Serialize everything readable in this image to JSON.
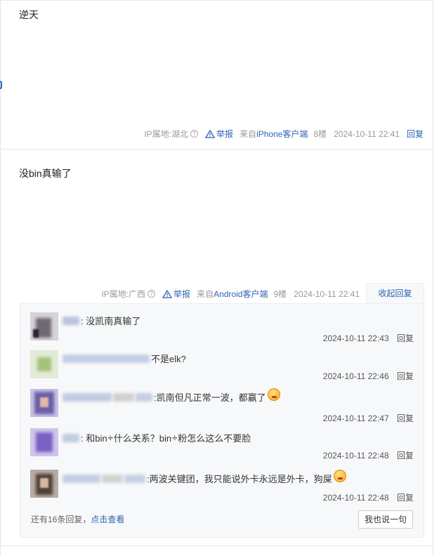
{
  "posts": [
    {
      "text": "逆天",
      "meta": {
        "ip": "IP属地:湖北",
        "report": "举报",
        "from": "来自",
        "client": "iPhone客户端",
        "floor": "8楼",
        "time": "2024-10-11 22:41",
        "reply": "回复"
      }
    },
    {
      "text": "没bin真输了",
      "meta": {
        "ip": "IP属地:广西",
        "report": "举报",
        "from": "来自",
        "client": "Android客户端",
        "floor": "9楼",
        "time": "2024-10-11 22:41",
        "reply": "收起回复"
      }
    }
  ],
  "subreplies": [
    {
      "text": ": 没凯南真输了",
      "time": "2024-10-11 22:43",
      "reply": "回复"
    },
    {
      "text": " 不是elk?",
      "time": "2024-10-11 22:46",
      "reply": "回复"
    },
    {
      "text": ":凯南但凡正常一波，都赢了",
      "time": "2024-10-11 22:47",
      "reply": "回复"
    },
    {
      "text_a": ": 和bin",
      "text_b": "什么关系？bin",
      "text_c": "粉怎么这么不要脸",
      "time": "2024-10-11 22:48",
      "reply": "回复"
    },
    {
      "text": ":两波关键团，我只能说外卡永远是外卡，狗屎",
      "time": "2024-10-11 22:48",
      "reply": "回复"
    }
  ],
  "footer": {
    "more_prefix": "还有16条回复，",
    "more_link": "点击查看",
    "say_button": "我也说一句"
  },
  "colors": {
    "link": "#2d64b3",
    "panel_bg": "#f7f8fa"
  },
  "icons": {
    "question": "?",
    "divide": "÷"
  }
}
